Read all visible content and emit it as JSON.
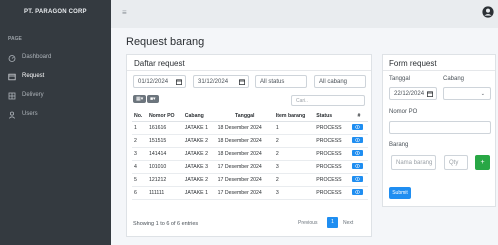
{
  "app": {
    "brand": "PT. PARAGON CORP"
  },
  "sidebar": {
    "heading": "PAGE",
    "items": [
      {
        "label": "Dashboard",
        "icon": "dashboard-icon",
        "active": false
      },
      {
        "label": "Request",
        "icon": "request-icon",
        "active": true
      },
      {
        "label": "Delivery",
        "icon": "delivery-icon",
        "active": false
      },
      {
        "label": "Users",
        "icon": "users-icon",
        "active": false
      }
    ]
  },
  "page": {
    "title": "Request barang"
  },
  "list_card": {
    "title": "Daftar request",
    "filters": {
      "date_from": "01/12/2024",
      "date_to": "31/12/2024",
      "status": "All status",
      "branch": "All cabang"
    },
    "search_placeholder": "Cari..",
    "columns": [
      "No.",
      "Nomor PO",
      "Cabang",
      "Tanggal",
      "Item barang",
      "Status",
      "#"
    ],
    "rows": [
      [
        "1",
        "161616",
        "JATAKE 1",
        "18 Desember 2024",
        "1",
        "PROCESS"
      ],
      [
        "2",
        "151515",
        "JATAKE 2",
        "18 Desember 2024",
        "2",
        "PROCESS"
      ],
      [
        "3",
        "141414",
        "JATAKE 2",
        "18 Desember 2024",
        "2",
        "PROCESS"
      ],
      [
        "4",
        "101010",
        "JATAKE 3",
        "17 Desember 2024",
        "3",
        "PROCESS"
      ],
      [
        "5",
        "121212",
        "JATAKE 2",
        "17 Desember 2024",
        "2",
        "PROCESS"
      ],
      [
        "6",
        "111111",
        "JATAKE 1",
        "17 Desember 2024",
        "3",
        "PROCESS"
      ]
    ],
    "footer": "Showing 1 to 6 of 6 entries",
    "pagination": {
      "previous": "Previous",
      "current": "1",
      "next": "Next"
    }
  },
  "form_card": {
    "title": "Form request",
    "tanggal_label": "Tanggal",
    "tanggal_value": "22/12/2024",
    "cabang_label": "Cabang",
    "po_label": "Nomor PO",
    "barang_label": "Barang",
    "barang_placeholder": "Nama barang",
    "qty_placeholder": "Qty",
    "add_label": "+",
    "submit_label": "Submit"
  },
  "colors": {
    "accent": "#1f8ef1",
    "sidebar": "#343a40",
    "success": "#28a745"
  }
}
